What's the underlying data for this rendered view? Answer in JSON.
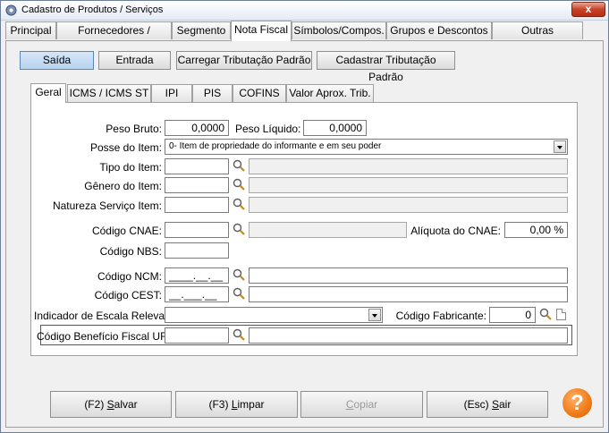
{
  "window": {
    "title": "Cadastro de Produtos / Serviços",
    "close_label": "x"
  },
  "top_tabs": [
    "Principal",
    "Fornecedores / Estoque",
    "Segmento",
    "Nota Fiscal",
    "Símbolos/Compos.",
    "Grupos e Descontos",
    "Outras Informações"
  ],
  "mode_buttons": {
    "saida": "Saída",
    "entrada": "Entrada",
    "carregar": "Carregar Tributação Padrão",
    "cadastrar": "Cadastrar Tributação Padrão"
  },
  "inner_tabs": [
    "Geral",
    "ICMS / ICMS ST",
    "IPI",
    "PIS",
    "COFINS",
    "Valor Aprox. Trib."
  ],
  "form": {
    "peso_bruto": {
      "label": "Peso Bruto:",
      "value": "0,0000"
    },
    "peso_liquido": {
      "label": "Peso Líquido:",
      "value": "0,0000"
    },
    "posse_item": {
      "label": "Posse do Item:",
      "value": "0- Item de propriedade do informante e em seu poder"
    },
    "tipo_item": {
      "label": "Tipo do Item:",
      "value": "",
      "desc": ""
    },
    "genero_item": {
      "label": "Gênero do Item:",
      "value": "",
      "desc": ""
    },
    "natureza_servico": {
      "label": "Natureza Serviço Item:",
      "value": "",
      "desc": ""
    },
    "codigo_cnae": {
      "label": "Código CNAE:",
      "value": "",
      "desc": ""
    },
    "aliquota_cnae": {
      "label": "Alíquota do CNAE:",
      "value": "0,00 %"
    },
    "codigo_nbs": {
      "label": "Código NBS:",
      "value": ""
    },
    "codigo_ncm": {
      "label": "Código NCM:",
      "mask": "____.__.__",
      "desc": ""
    },
    "codigo_cest": {
      "label": "Código CEST:",
      "mask": "__.___.__",
      "desc": ""
    },
    "indicador_escala": {
      "label": "Indicador de Escala Relevante:",
      "value": ""
    },
    "codigo_fabricante": {
      "label": "Código Fabricante:",
      "value": "0"
    },
    "codigo_beneficio": {
      "label": "Código Benefício Fiscal UF:",
      "value": "",
      "desc": ""
    }
  },
  "bottom_buttons": {
    "salvar": {
      "prefix": "(F2) ",
      "underline": "S",
      "rest": "alvar"
    },
    "limpar": {
      "prefix": "(F3) ",
      "underline": "L",
      "rest": "impar"
    },
    "copiar": {
      "prefix": "",
      "underline": "C",
      "rest": "opiar"
    },
    "sair": {
      "prefix": "(Esc) ",
      "underline": "S",
      "rest": "air"
    },
    "help": "?"
  },
  "colors": {
    "highlight_border": "#d1222b",
    "help_orange": "#f07a16",
    "active_mode": "#b8d3ee"
  }
}
